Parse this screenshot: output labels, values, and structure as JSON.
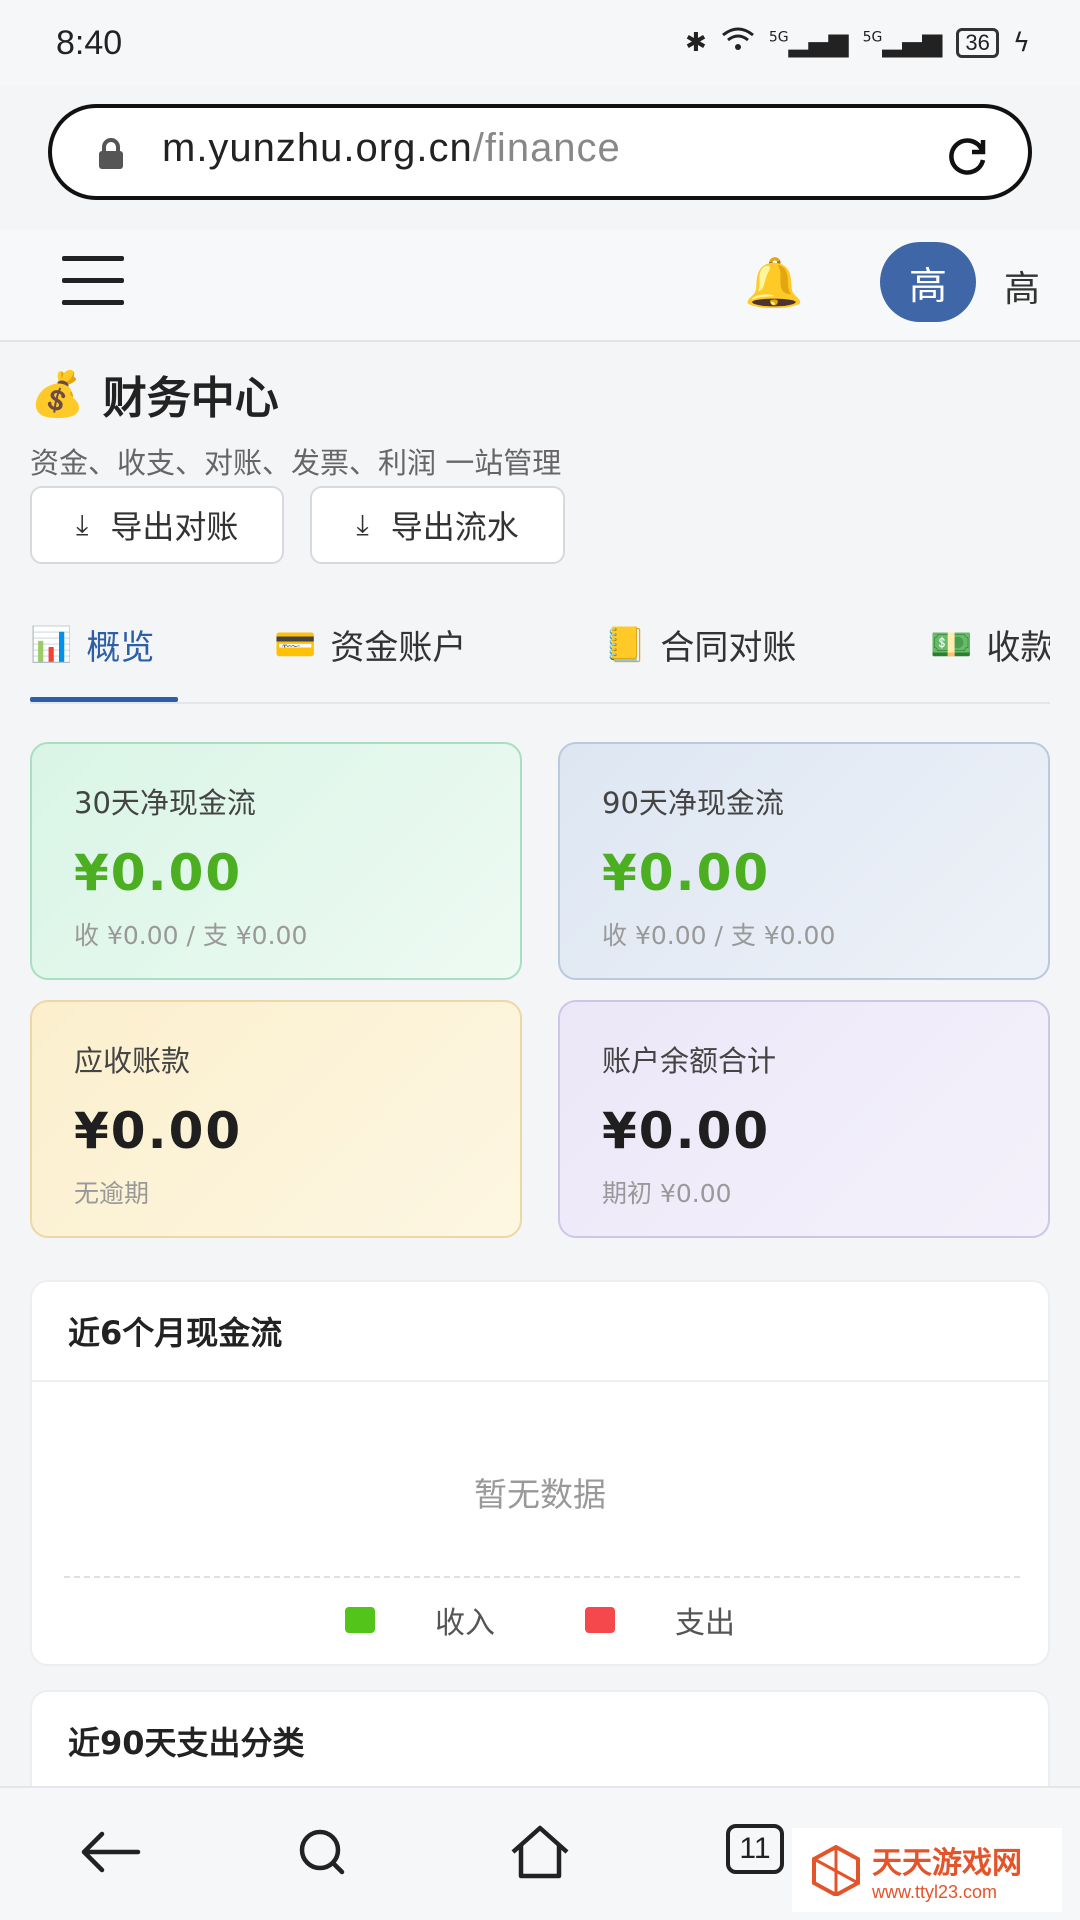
{
  "status_bar": {
    "time": "8:40",
    "battery": "36",
    "network": [
      "5G",
      "5G"
    ]
  },
  "browser": {
    "url_host": "m.yunzhu.org.cn",
    "url_path": "/finance",
    "tab_count": "11"
  },
  "header": {
    "avatar_initial": "高",
    "user_name": "高"
  },
  "page": {
    "title_emoji": "💰",
    "title": "财务中心",
    "subtitle": "资金、收支、对账、发票、利润 一站管理"
  },
  "actions": {
    "export_recon": "导出对账",
    "export_flow": "导出流水"
  },
  "tabs": [
    {
      "icon": "📊",
      "label": "概览"
    },
    {
      "icon": "💳",
      "label": "资金账户"
    },
    {
      "icon": "📒",
      "label": "合同对账"
    },
    {
      "icon": "💵",
      "label": "收款"
    }
  ],
  "cards": {
    "cash30": {
      "label": "30天净现金流",
      "value": "¥0.00",
      "sub": "收 ¥0.00 / 支 ¥0.00"
    },
    "cash90": {
      "label": "90天净现金流",
      "value": "¥0.00",
      "sub": "收 ¥0.00 / 支 ¥0.00"
    },
    "receivable": {
      "label": "应收账款",
      "value": "¥0.00",
      "sub": "无逾期"
    },
    "balance": {
      "label": "账户余额合计",
      "value": "¥0.00",
      "sub": "期初 ¥0.00"
    }
  },
  "cashflow_panel": {
    "title": "近6个月现金流",
    "empty_text": "暂无数据",
    "legend": [
      {
        "name": "收入",
        "color": "#52c41a"
      },
      {
        "name": "支出",
        "color": "#f5484d"
      }
    ]
  },
  "expense_panel": {
    "title": "近90天支出分类"
  },
  "watermark": {
    "brand": "天天游戏网",
    "site": "www.ttyl23.com"
  },
  "colors": {
    "accent": "#2d5fa6",
    "positive": "#4caf22",
    "avatar": "#3f67a8"
  }
}
